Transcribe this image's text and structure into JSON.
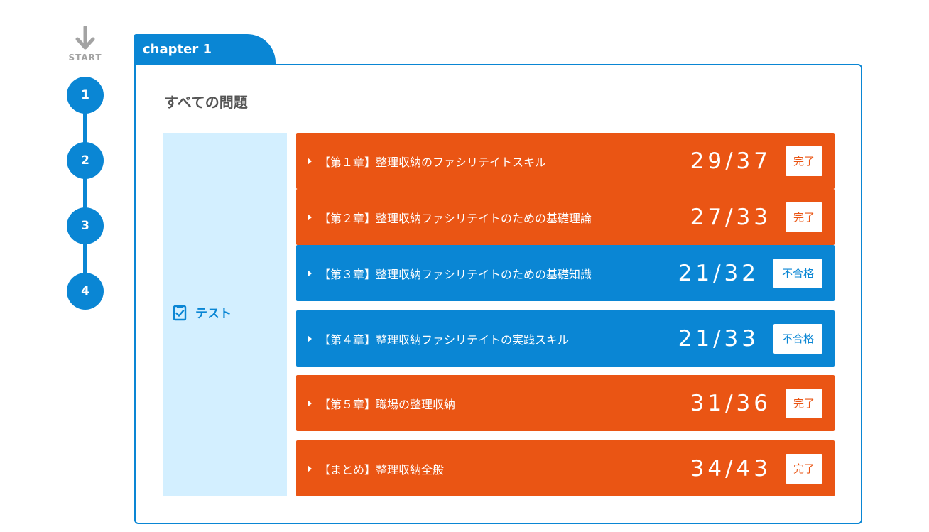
{
  "rail": {
    "start_label": "START",
    "steps": [
      "1",
      "2",
      "3",
      "4"
    ]
  },
  "chapter": {
    "tab_label": "chapter 1",
    "section_title": "すべての問題",
    "category_label": "テスト",
    "rows": [
      {
        "title": "【第１章】整理収納のファシリテイトスキル",
        "score": "29/37",
        "status": "完了",
        "color": "orange"
      },
      {
        "title": "【第２章】整理収納ファシリテイトのための基礎理論",
        "score": "27/33",
        "status": "完了",
        "color": "orange"
      },
      {
        "title": "【第３章】整理収納ファシリテイトのための基礎知識",
        "score": "21/32",
        "status": "不合格",
        "color": "blue"
      },
      {
        "title": "【第４章】整理収納ファシリテイトの実践スキル",
        "score": "21/33",
        "status": "不合格",
        "color": "blue"
      },
      {
        "title": "【第５章】職場の整理収納",
        "score": "31/36",
        "status": "完了",
        "color": "orange"
      },
      {
        "title": "【まとめ】整理収納全般",
        "score": "34/43",
        "status": "完了",
        "color": "orange"
      }
    ]
  },
  "colors": {
    "primary_blue": "#0a86d4",
    "accent_orange": "#ea5514",
    "category_bg": "#d3efff"
  },
  "icons": {
    "start": "arrow-down-icon",
    "category": "checklist-icon",
    "row": "caret-right-icon"
  }
}
